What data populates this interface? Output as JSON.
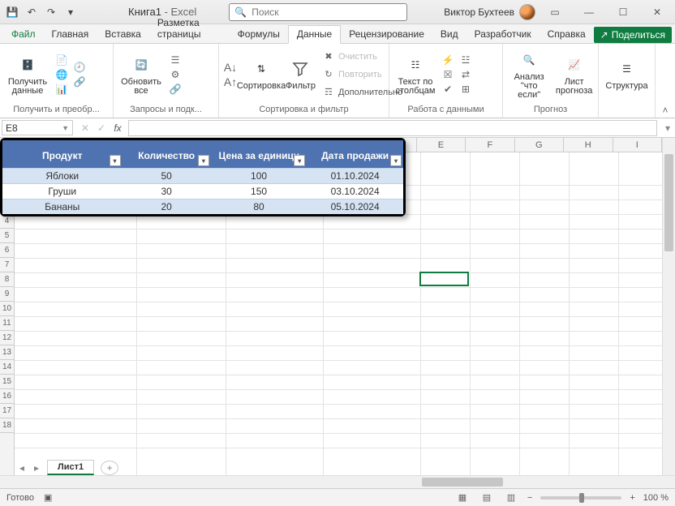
{
  "titlebar": {
    "doc": "Книга1",
    "app": "Excel",
    "search_placeholder": "Поиск",
    "user": "Виктор Бухтеев"
  },
  "tabs": {
    "file": "Файл",
    "items": [
      "Главная",
      "Вставка",
      "Разметка страницы",
      "Формулы",
      "Данные",
      "Рецензирование",
      "Вид",
      "Разработчик",
      "Справка"
    ],
    "active_idx": 4,
    "share": "Поделиться"
  },
  "ribbon": {
    "groups": {
      "get": {
        "title": "Получить и преобр...",
        "btn": "Получить\nданные"
      },
      "queries": {
        "title": "Запросы и подк...",
        "btn": "Обновить\nвсе"
      },
      "sortfilt": {
        "title": "Сортировка и фильтр",
        "sort": "Сортировка",
        "filter": "Фильтр",
        "clear": "Очистить",
        "reapply": "Повторить",
        "adv": "Дополнительно"
      },
      "datatools": {
        "title": "Работа с данными",
        "textcols": "Текст по\nстолбцам"
      },
      "forecast": {
        "title": "Прогноз",
        "whatif": "Анализ \"что\nесли\"",
        "fcsheet": "Лист\nпрогноза"
      },
      "struct": {
        "title": "",
        "btn": "Структура"
      }
    }
  },
  "fbar": {
    "namebox": "E8",
    "x": "✕",
    "ck": "✓",
    "fx": "fx"
  },
  "sheet": {
    "active": "Лист1"
  },
  "status": {
    "ready": "Готово",
    "zoom": "100 %"
  },
  "table": {
    "headers": [
      "Продукт",
      "Количество",
      "Цена за единицу",
      "Дата продажи"
    ],
    "rows": [
      [
        "Яблоки",
        "50",
        "100",
        "01.10.2024"
      ],
      [
        "Груши",
        "30",
        "150",
        "03.10.2024"
      ],
      [
        "Бананы",
        "20",
        "80",
        "05.10.2024"
      ]
    ]
  },
  "chart_data": {
    "type": "table",
    "headers": [
      "Продукт",
      "Количество",
      "Цена за единицу",
      "Дата продажи"
    ],
    "rows": [
      {
        "Продукт": "Яблоки",
        "Количество": 50,
        "Цена за единицу": 100,
        "Дата продажи": "01.10.2024"
      },
      {
        "Продукт": "Груши",
        "Количество": 30,
        "Цена за единицу": 150,
        "Дата продажи": "03.10.2024"
      },
      {
        "Продукт": "Бананы",
        "Количество": 20,
        "Цена за единицу": 80,
        "Дата продажи": "05.10.2024"
      }
    ]
  }
}
